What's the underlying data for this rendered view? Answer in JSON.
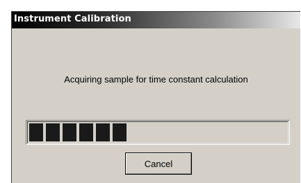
{
  "window": {
    "title": "Instrument Calibration"
  },
  "message": "Acquiring sample for time constant calculation",
  "progress": {
    "filled_chunks": 6,
    "fraction": 0.33
  },
  "buttons": {
    "cancel_label": "Cancel"
  },
  "colors": {
    "title_text": "#ffffff",
    "dialog_face": "#d4d0c8",
    "progress_chunk": "#1a1a1a"
  }
}
